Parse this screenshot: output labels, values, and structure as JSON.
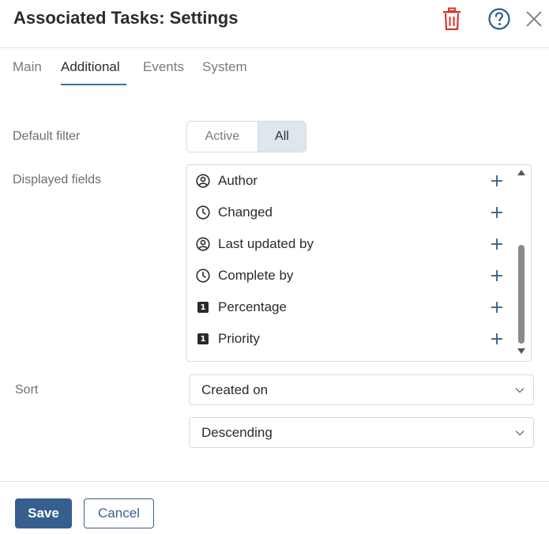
{
  "header": {
    "title": "Associated Tasks: Settings",
    "icons": [
      "trash-icon",
      "help-icon",
      "close-icon"
    ],
    "trash_color": "#d9342b",
    "help_color": "#2e5d8f"
  },
  "tabs": [
    {
      "label": "Main",
      "active": false
    },
    {
      "label": "Additional",
      "active": true
    },
    {
      "label": "Events",
      "active": false
    },
    {
      "label": "System",
      "active": false
    }
  ],
  "default_filter": {
    "label": "Default filter",
    "options": [
      "Active",
      "All"
    ],
    "selected": "All"
  },
  "displayed_fields": {
    "label": "Displayed fields",
    "items": [
      {
        "label": "Author",
        "icon": "user-icon"
      },
      {
        "label": "Changed",
        "icon": "clock-icon"
      },
      {
        "label": "Last updated by",
        "icon": "user-icon"
      },
      {
        "label": "Complete by",
        "icon": "clock-icon"
      },
      {
        "label": "Percentage",
        "icon": "number-icon",
        "badge": "1"
      },
      {
        "label": "Priority",
        "icon": "number-icon",
        "badge": "1"
      }
    ]
  },
  "sort": {
    "label": "Sort",
    "field_value": "Created on",
    "order_value": "Descending"
  },
  "footer": {
    "save_label": "Save",
    "cancel_label": "Cancel"
  },
  "colors": {
    "accent": "#365f8f",
    "tab_underline": "#3a6ea5",
    "selected_segment": "#dfe6ee"
  }
}
